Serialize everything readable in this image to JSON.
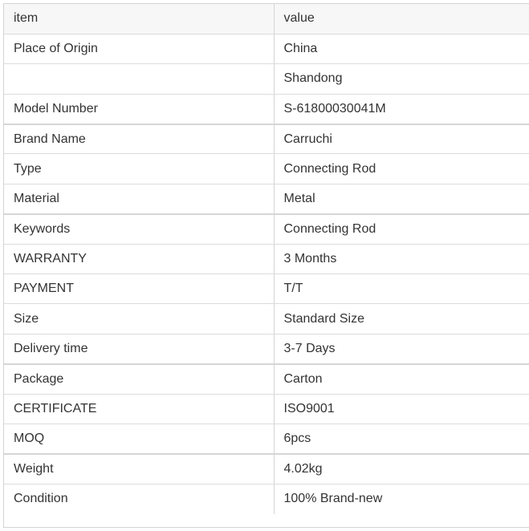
{
  "table": {
    "header": {
      "item": "item",
      "value": "value"
    },
    "rows": [
      {
        "item": "Place of Origin",
        "value": "China"
      },
      {
        "item": "",
        "value": "Shandong"
      },
      {
        "item": "Model Number",
        "value": "S-61800030041M"
      },
      {
        "item": "Brand Name",
        "value": "Carruchi"
      },
      {
        "item": "Type",
        "value": "Connecting Rod"
      },
      {
        "item": "Material",
        "value": "Metal"
      },
      {
        "item": "Keywords",
        "value": "Connecting Rod"
      },
      {
        "item": "WARRANTY",
        "value": "3 Months"
      },
      {
        "item": "PAYMENT",
        "value": "T/T"
      },
      {
        "item": "Size",
        "value": "Standard Size"
      },
      {
        "item": "Delivery time",
        "value": "3-7 Days"
      },
      {
        "item": "Package",
        "value": "Carton"
      },
      {
        "item": "CERTIFICATE",
        "value": "ISO9001"
      },
      {
        "item": "MOQ",
        "value": "6pcs"
      },
      {
        "item": "Weight",
        "value": "4.02kg"
      },
      {
        "item": "Condition",
        "value": "100% Brand-new"
      }
    ]
  }
}
